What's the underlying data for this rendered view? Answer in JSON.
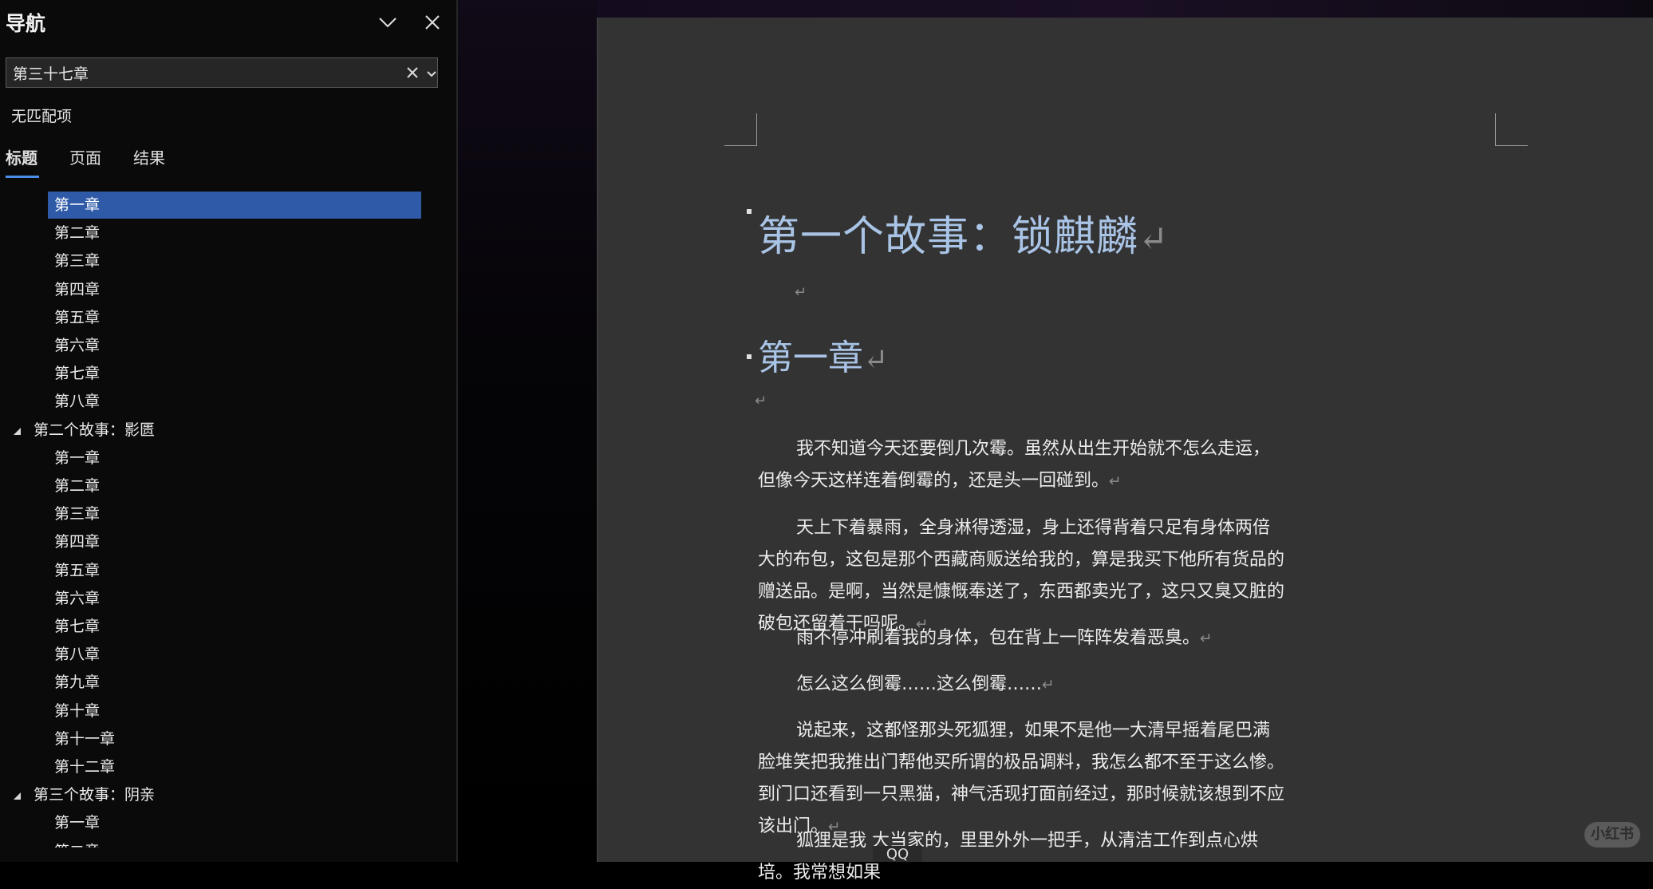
{
  "nav": {
    "title": "导航",
    "search_value": "第三十七章",
    "status": "无匹配项",
    "tabs": [
      "标题",
      "页面",
      "结果"
    ],
    "tree": [
      {
        "label": "第一章",
        "level": 1,
        "selected": true
      },
      {
        "label": "第二章",
        "level": 1
      },
      {
        "label": "第三章",
        "level": 1
      },
      {
        "label": "第四章",
        "level": 1
      },
      {
        "label": "第五章",
        "level": 1
      },
      {
        "label": "第六章",
        "level": 1
      },
      {
        "label": "第七章",
        "level": 1
      },
      {
        "label": "第八章",
        "level": 1
      },
      {
        "label": "第二个故事：影匮",
        "level": 0
      },
      {
        "label": "第一章",
        "level": 1
      },
      {
        "label": "第二章",
        "level": 1
      },
      {
        "label": "第三章",
        "level": 1
      },
      {
        "label": "第四章",
        "level": 1
      },
      {
        "label": "第五章",
        "level": 1
      },
      {
        "label": "第六章",
        "level": 1
      },
      {
        "label": "第七章",
        "level": 1
      },
      {
        "label": "第八章",
        "level": 1
      },
      {
        "label": "第九章",
        "level": 1
      },
      {
        "label": "第十章",
        "level": 1
      },
      {
        "label": "第十一章",
        "level": 1
      },
      {
        "label": "第十二章",
        "level": 1
      },
      {
        "label": "第三个故事：阴亲",
        "level": 0
      },
      {
        "label": "第一章",
        "level": 1
      },
      {
        "label": "第二章",
        "level": 1
      }
    ]
  },
  "document": {
    "title": "第一个故事：锁麒麟",
    "heading": "第一章",
    "paragraphs": [
      "我不知道今天还要倒几次霉。虽然从出生开始就不怎么走运，但像今天这样连着倒霉的，还是头一回碰到。",
      "天上下着暴雨，全身淋得透湿，身上还得背着只足有身体两倍大的布包，这包是那个西藏商贩送给我的，算是我买下他所有货品的赠送品。是啊，当然是慷慨奉送了，东西都卖光了，这只又臭又脏的破包还留着干吗呢。",
      "雨不停冲刷着我的身体，包在背上一阵阵发着恶臭。",
      "怎么这么倒霉……这么倒霉……",
      "说起来，这都怪那头死狐狸，如果不是他一大清早摇着尾巴满脸堆笑把我推出门帮他买所谓的极品调料，我怎么都不至于这么惨。到门口还看到一只黑猫，神气活现打面前经过，那时候就该想到不应该出门。",
      "狐狸是我 大当家的，里里外外一把手，从清洁工作到点心烘培。我常想如果"
    ],
    "para_mark": "↵"
  },
  "overlay": {
    "qq_label": "QQ",
    "watermark": "小红书"
  }
}
